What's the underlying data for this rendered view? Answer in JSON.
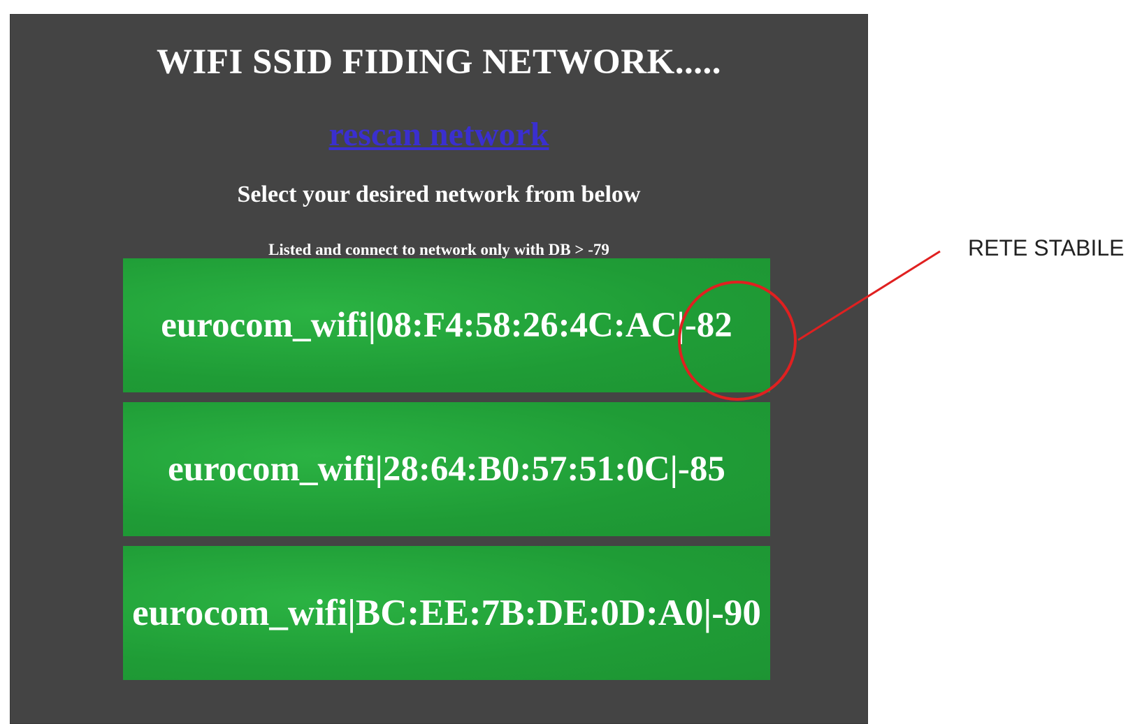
{
  "page": {
    "title": "WIFI SSID FIDING NETWORK.....",
    "rescan_link": "rescan network",
    "instruction": "Select your desired network from below",
    "note": "Listed and connect to network only with DB > -79"
  },
  "networks": [
    {
      "label": "eurocom_wifi|08:F4:58:26:4C:AC|-82"
    },
    {
      "label": "eurocom_wifi|28:64:B0:57:51:0C|-85"
    },
    {
      "label": "eurocom_wifi|BC:EE:7B:DE:0D:A0|-90"
    }
  ],
  "annotation": {
    "label": "RETE STABILE",
    "color": "#e02020"
  },
  "colors": {
    "panel_bg": "#444444",
    "button_bg": "#22a33a",
    "link": "#3a2fd0",
    "text": "#ffffff"
  }
}
